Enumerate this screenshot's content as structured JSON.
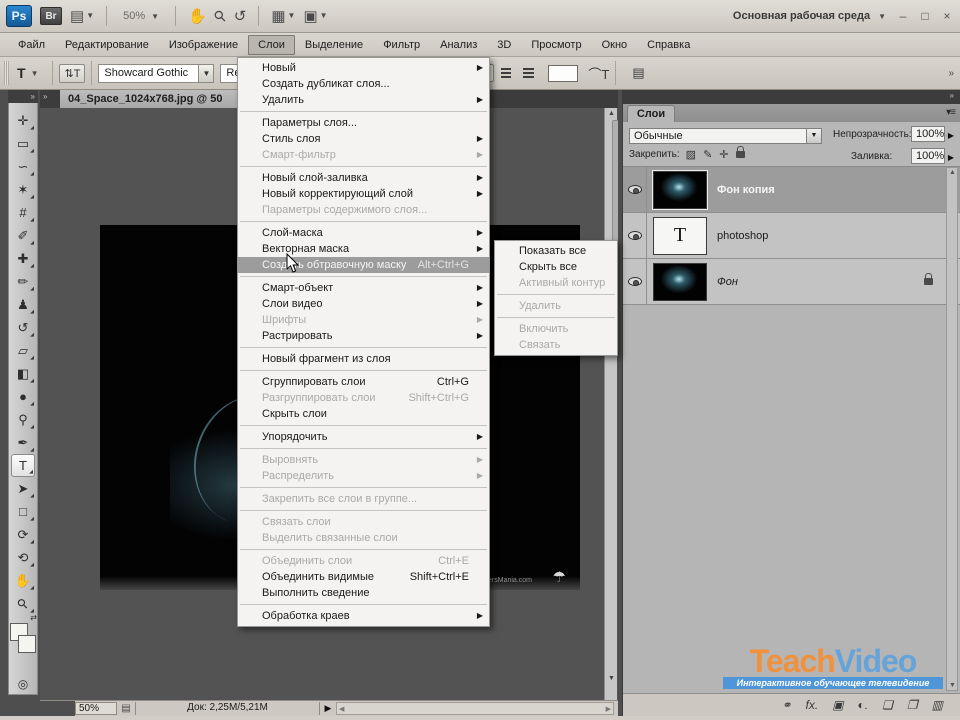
{
  "titlebar": {
    "ps_logo": "Ps",
    "bridge": "Br",
    "zoom_value": "50%",
    "workspace": "Основная рабочая среда",
    "minimize": "–",
    "maximize": "□",
    "close": "×"
  },
  "menubar": {
    "items": [
      {
        "label": "Файл"
      },
      {
        "label": "Редактирование"
      },
      {
        "label": "Изображение"
      },
      {
        "label": "Слои",
        "active": true
      },
      {
        "label": "Выделение"
      },
      {
        "label": "Фильтр"
      },
      {
        "label": "Анализ"
      },
      {
        "label": "3D"
      },
      {
        "label": "Просмотр"
      },
      {
        "label": "Окно"
      },
      {
        "label": "Справка"
      }
    ]
  },
  "optionsbar": {
    "tool_letter": "T",
    "font_name": "Showcard Gothic",
    "font_style": "Regu",
    "chevrons": "»"
  },
  "toolbar": {
    "collapse": "»",
    "tools": [
      {
        "name": "move-tool",
        "glyph": "✛"
      },
      {
        "name": "rectangular-marquee-tool",
        "glyph": "▭"
      },
      {
        "name": "lasso-tool",
        "glyph": "∽"
      },
      {
        "name": "magic-wand-tool",
        "glyph": "✶"
      },
      {
        "name": "crop-tool",
        "glyph": "#"
      },
      {
        "name": "eyedropper-tool",
        "glyph": "✐"
      },
      {
        "name": "healing-brush-tool",
        "glyph": "✚"
      },
      {
        "name": "brush-tool",
        "glyph": "✏"
      },
      {
        "name": "clone-stamp-tool",
        "glyph": "♟"
      },
      {
        "name": "history-brush-tool",
        "glyph": "↺"
      },
      {
        "name": "eraser-tool",
        "glyph": "▱"
      },
      {
        "name": "gradient-tool",
        "glyph": "◧"
      },
      {
        "name": "blur-tool",
        "glyph": "●"
      },
      {
        "name": "dodge-tool",
        "glyph": "⚲"
      },
      {
        "name": "pen-tool",
        "glyph": "✒"
      },
      {
        "name": "type-tool",
        "glyph": "T",
        "active": true
      },
      {
        "name": "path-selection-tool",
        "glyph": "➤"
      },
      {
        "name": "shape-tool",
        "glyph": "□"
      },
      {
        "name": "rotate-3d-tool",
        "glyph": "⟳"
      },
      {
        "name": "orbit-3d-tool",
        "glyph": "⟲"
      },
      {
        "name": "hand-tool",
        "glyph": "✋"
      },
      {
        "name": "zoom-tool",
        "glyph": "⚲",
        "rot": true
      }
    ]
  },
  "document": {
    "tab_title": "04_Space_1024x768.jpg @ 50",
    "image_watermark": "www.WallpapersMania.com"
  },
  "statusbar": {
    "zoom": "50%",
    "doc_info": "Док: 2,25М/5,21М"
  },
  "layers_menu": {
    "items": [
      {
        "label": "Новый",
        "arrow": true
      },
      {
        "label": "Создать дубликат слоя..."
      },
      {
        "label": "Удалить",
        "arrow": true
      },
      {
        "sep": true
      },
      {
        "label": "Параметры слоя..."
      },
      {
        "label": "Стиль слоя",
        "arrow": true
      },
      {
        "label": "Смарт-фильтр",
        "arrow": true,
        "disabled": true
      },
      {
        "sep": true
      },
      {
        "label": "Новый слой-заливка",
        "arrow": true
      },
      {
        "label": "Новый корректирующий слой",
        "arrow": true
      },
      {
        "label": "Параметры содержимого слоя...",
        "disabled": true
      },
      {
        "sep": true
      },
      {
        "label": "Слой-маска",
        "arrow": true
      },
      {
        "label": "Векторная маска",
        "arrow": true
      },
      {
        "label": "Создать обтравочную маску",
        "shortcut": "Alt+Ctrl+G",
        "highlighted": true
      },
      {
        "sep": true
      },
      {
        "label": "Смарт-объект",
        "arrow": true
      },
      {
        "label": "Слои видео",
        "arrow": true
      },
      {
        "label": "Шрифты",
        "arrow": true,
        "disabled": true
      },
      {
        "label": "Растрировать",
        "arrow": true
      },
      {
        "sep": true
      },
      {
        "label": "Новый фрагмент из слоя"
      },
      {
        "sep": true
      },
      {
        "label": "Сгруппировать слои",
        "shortcut": "Ctrl+G"
      },
      {
        "label": "Разгруппировать слои",
        "shortcut": "Shift+Ctrl+G",
        "disabled": true
      },
      {
        "label": "Скрыть слои"
      },
      {
        "sep": true
      },
      {
        "label": "Упорядочить",
        "arrow": true
      },
      {
        "sep": true
      },
      {
        "label": "Выровнять",
        "arrow": true,
        "disabled": true
      },
      {
        "label": "Распределить",
        "arrow": true,
        "disabled": true
      },
      {
        "sep": true
      },
      {
        "label": "Закрепить все слои в группе...",
        "disabled": true
      },
      {
        "sep": true
      },
      {
        "label": "Связать слои",
        "disabled": true
      },
      {
        "label": "Выделить связанные слои",
        "disabled": true
      },
      {
        "sep": true
      },
      {
        "label": "Объединить слои",
        "shortcut": "Ctrl+E",
        "disabled": true
      },
      {
        "label": "Объединить видимые",
        "shortcut": "Shift+Ctrl+E"
      },
      {
        "label": "Выполнить сведение"
      },
      {
        "sep": true
      },
      {
        "label": "Обработка краев",
        "arrow": true
      }
    ]
  },
  "mask_submenu": {
    "items": [
      {
        "label": "Показать все"
      },
      {
        "label": "Скрыть все"
      },
      {
        "label": "Активный контур",
        "disabled": true
      },
      {
        "sep": true
      },
      {
        "label": "Удалить",
        "disabled": true
      },
      {
        "sep": true
      },
      {
        "label": "Включить",
        "disabled": true
      },
      {
        "label": "Связать",
        "disabled": true
      }
    ]
  },
  "layers_panel": {
    "collapse": "»",
    "tab_label": "Слои",
    "blend_mode": "Обычные",
    "opacity_label": "Непрозрачность:",
    "opacity_value": "100%",
    "lock_label": "Закрепить:",
    "fill_label": "Заливка:",
    "fill_value": "100%",
    "lock_icons": [
      {
        "name": "lock-transparency-icon",
        "glyph": "▨"
      },
      {
        "name": "lock-pixels-icon",
        "glyph": "✎"
      },
      {
        "name": "lock-position-icon",
        "glyph": "✛"
      },
      {
        "name": "lock-all-icon",
        "css": "padlock"
      }
    ],
    "layers": [
      {
        "name": "Фон копия",
        "selected": true,
        "thumb": "space"
      },
      {
        "name": "photoshop",
        "thumb": "text",
        "thumb_label": "T"
      },
      {
        "name": "Фон",
        "thumb": "space",
        "italic": true,
        "locked": true
      }
    ],
    "bottom_icons": [
      {
        "name": "link-layers-icon",
        "glyph": "⚭"
      },
      {
        "name": "layer-style-icon",
        "glyph": "fx."
      },
      {
        "name": "add-layer-mask-icon",
        "glyph": "▣"
      },
      {
        "name": "adjustment-layer-icon",
        "glyph": "◐."
      },
      {
        "name": "new-group-icon",
        "glyph": "❏"
      },
      {
        "name": "new-layer-icon",
        "glyph": "❐"
      },
      {
        "name": "delete-layer-icon",
        "glyph": "▥"
      }
    ]
  },
  "teachvideo": {
    "teach": "Teach",
    "video": "Video",
    "tagline": "Интерактивное обучающее телевидение"
  },
  "colors": {
    "ps_blue": "#1f72b8",
    "teach_orange": "#f0913e",
    "video_blue": "#66a3d9",
    "band_blue": "#4f96d8"
  }
}
